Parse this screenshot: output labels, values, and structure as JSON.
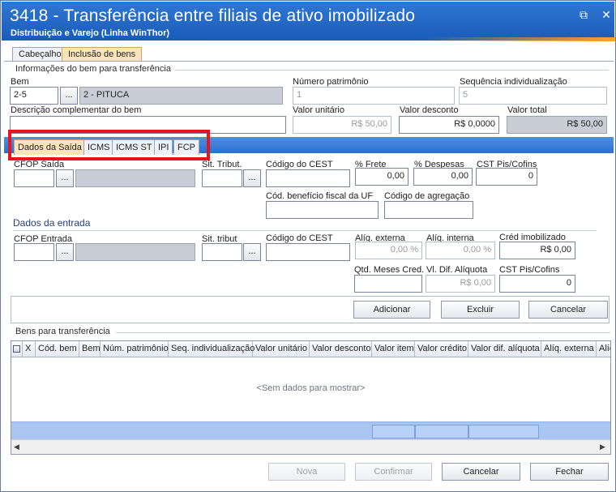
{
  "window": {
    "title": "3418 - Transferência entre filiais de ativo imobilizado",
    "subtitle": "Distribuição e Varejo (Linha WinThor)",
    "buttons": {
      "restore": "⧉",
      "close": "✕"
    }
  },
  "tabs": [
    {
      "label": "Cabeçalho",
      "active": false
    },
    {
      "label": "Inclusão de bens",
      "active": true
    }
  ],
  "asset_group": {
    "title": "Informações do bem para transferência",
    "bem_label": "Bem",
    "bem_code": "2-5",
    "bem_name": "2 - PITUCA",
    "lookup_label": "...",
    "numero_patrimonio_label": "Número patrimônio",
    "numero_patrimonio_value": "1",
    "sequencia_label": "Sequência individualização",
    "sequencia_value": "5",
    "descricao_label": "Descrição complementar do bem",
    "descricao_value": "",
    "valor_unitario_label": "Valor unitário",
    "valor_unitario_value": "R$ 50,00",
    "valor_desconto_label": "Valor desconto",
    "valor_desconto_value": "R$ 0,0000",
    "valor_total_label": "Valor total",
    "valor_total_value": "R$ 50,00"
  },
  "subtabs": [
    {
      "label": "Dados da Saída",
      "active": true
    },
    {
      "label": "ICMS",
      "active": false
    },
    {
      "label": "ICMS ST",
      "active": false
    },
    {
      "label": "IPI",
      "active": false
    },
    {
      "label": "FCP",
      "active": false
    }
  ],
  "saida": {
    "cfop_label": "CFOP Saída",
    "sit_tribut_label": "Sit. Tribut.",
    "cest_label": "Código do CEST",
    "frete_label": "% Frete",
    "frete_value": "0,00",
    "despesas_label": "% Despesas",
    "despesas_value": "0,00",
    "cst_label": "CST Pis/Cofins",
    "cst_value": "0",
    "beneficio_label": "Cód. benefício fiscal da UF",
    "agregacao_label": "Código de agregação"
  },
  "entrada": {
    "section_title": "Dados da entrada",
    "cfop_label": "CFOP Entrada",
    "sit_tribut_label": "Sit. tribut",
    "cest_label": "Código do CEST",
    "aliq_externa_label": "Alíq. externa",
    "aliq_externa_value": "0,00 %",
    "aliq_interna_label": "Alíq. interna",
    "aliq_interna_value": "0,00 %",
    "cred_imob_label": "Créd imobilizado",
    "cred_imob_value": "R$ 0,00",
    "qtd_meses_label": "Qtd. Meses Cred.",
    "vl_dif_label": "Vl. Dif. Alíquota",
    "vl_dif_value": "R$ 0,00",
    "cst_label": "CST Pis/Cofins",
    "cst_value": "0"
  },
  "actions": {
    "adicionar": "Adicionar",
    "excluir": "Excluir",
    "cancelar": "Cancelar"
  },
  "grid": {
    "title": "Bens para transferência",
    "columns": [
      "X",
      "Cód. bem",
      "Bem",
      "Núm. patrimônio",
      "Seq. individualização",
      "Valor unitário",
      "Valor desconto",
      "Valor item",
      "Valor crédito",
      "Valor dif. alíquota",
      "Alíq. externa",
      "Alíq"
    ],
    "empty_text": "<Sem dados para mostrar>"
  },
  "footer": {
    "nova": "Nova",
    "confirmar": "Confirmar",
    "cancelar": "Cancelar",
    "fechar": "Fechar"
  },
  "colors": {
    "title_blue": "#1f63c4",
    "tab_active": "#fde4b8",
    "highlight_red": "#e8131b",
    "section_blue": "#283c7a"
  }
}
